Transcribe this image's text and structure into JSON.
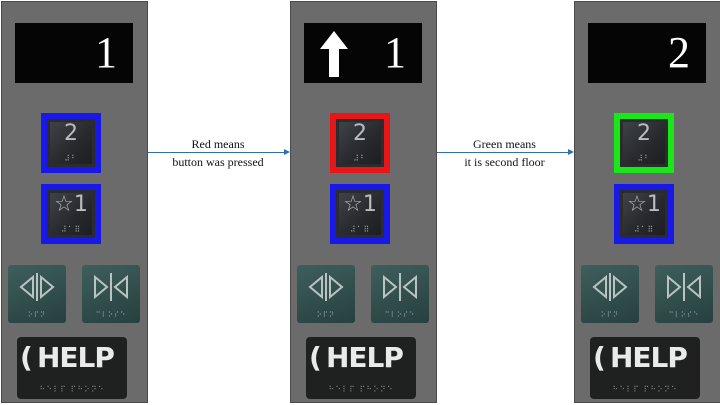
{
  "panels": [
    {
      "display": {
        "floor": "1",
        "arrow": ""
      },
      "buttons": {
        "two": {
          "label": "2",
          "braille": "⠼⠃",
          "state": "normal"
        },
        "one": {
          "label": "☆1",
          "braille": "⠼⠁⠿",
          "state": "normal"
        }
      },
      "doors": {
        "open_dots": "⠕⠏⠝",
        "close_dots": "⠉⠇⠕⠎⠑"
      },
      "help": {
        "label": "HELP",
        "phone": "(",
        "dots": "⠓⠑⠇⠏ ⠏⠓⠕⠝⠑"
      }
    },
    {
      "display": {
        "floor": "1",
        "arrow": "up"
      },
      "buttons": {
        "two": {
          "label": "2",
          "braille": "⠼⠃",
          "state": "pressed"
        },
        "one": {
          "label": "☆1",
          "braille": "⠼⠁⠿",
          "state": "normal"
        }
      },
      "doors": {
        "open_dots": "⠕⠏⠝",
        "close_dots": "⠉⠇⠕⠎⠑"
      },
      "help": {
        "label": "HELP",
        "phone": "(",
        "dots": "⠓⠑⠇⠏ ⠏⠓⠕⠝⠑"
      }
    },
    {
      "display": {
        "floor": "2",
        "arrow": ""
      },
      "buttons": {
        "two": {
          "label": "2",
          "braille": "⠼⠃",
          "state": "current"
        },
        "one": {
          "label": "☆1",
          "braille": "⠼⠁⠿",
          "state": "normal"
        }
      },
      "doors": {
        "open_dots": "⠕⠏⠝",
        "close_dots": "⠉⠇⠕⠎⠑"
      },
      "help": {
        "label": "HELP",
        "phone": "(",
        "dots": "⠓⠑⠇⠏ ⠏⠓⠕⠝⠑"
      }
    }
  ],
  "captions": [
    {
      "line1": "Red means",
      "line2": "button was pressed"
    },
    {
      "line1": "Green means",
      "line2": "it is second floor"
    }
  ],
  "colors": {
    "normal_border": "#1818e8",
    "pressed_border": "#e81616",
    "current_border": "#18e818",
    "arrow": "#2c6fb3"
  }
}
